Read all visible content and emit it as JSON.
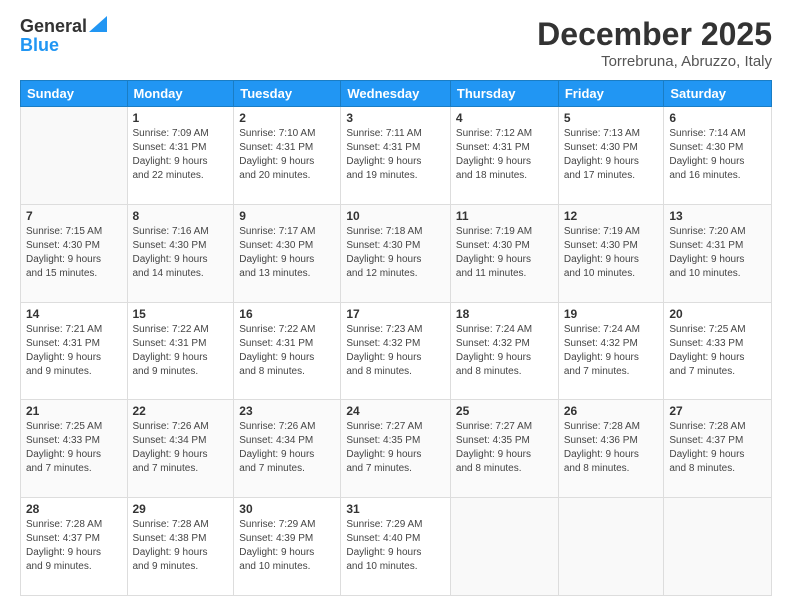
{
  "logo": {
    "general": "General",
    "blue": "Blue"
  },
  "title": "December 2025",
  "location": "Torrebruna, Abruzzo, Italy",
  "days_of_week": [
    "Sunday",
    "Monday",
    "Tuesday",
    "Wednesday",
    "Thursday",
    "Friday",
    "Saturday"
  ],
  "weeks": [
    [
      {
        "day": "",
        "info": ""
      },
      {
        "day": "1",
        "info": "Sunrise: 7:09 AM\nSunset: 4:31 PM\nDaylight: 9 hours\nand 22 minutes."
      },
      {
        "day": "2",
        "info": "Sunrise: 7:10 AM\nSunset: 4:31 PM\nDaylight: 9 hours\nand 20 minutes."
      },
      {
        "day": "3",
        "info": "Sunrise: 7:11 AM\nSunset: 4:31 PM\nDaylight: 9 hours\nand 19 minutes."
      },
      {
        "day": "4",
        "info": "Sunrise: 7:12 AM\nSunset: 4:31 PM\nDaylight: 9 hours\nand 18 minutes."
      },
      {
        "day": "5",
        "info": "Sunrise: 7:13 AM\nSunset: 4:30 PM\nDaylight: 9 hours\nand 17 minutes."
      },
      {
        "day": "6",
        "info": "Sunrise: 7:14 AM\nSunset: 4:30 PM\nDaylight: 9 hours\nand 16 minutes."
      }
    ],
    [
      {
        "day": "7",
        "info": "Sunrise: 7:15 AM\nSunset: 4:30 PM\nDaylight: 9 hours\nand 15 minutes."
      },
      {
        "day": "8",
        "info": "Sunrise: 7:16 AM\nSunset: 4:30 PM\nDaylight: 9 hours\nand 14 minutes."
      },
      {
        "day": "9",
        "info": "Sunrise: 7:17 AM\nSunset: 4:30 PM\nDaylight: 9 hours\nand 13 minutes."
      },
      {
        "day": "10",
        "info": "Sunrise: 7:18 AM\nSunset: 4:30 PM\nDaylight: 9 hours\nand 12 minutes."
      },
      {
        "day": "11",
        "info": "Sunrise: 7:19 AM\nSunset: 4:30 PM\nDaylight: 9 hours\nand 11 minutes."
      },
      {
        "day": "12",
        "info": "Sunrise: 7:19 AM\nSunset: 4:30 PM\nDaylight: 9 hours\nand 10 minutes."
      },
      {
        "day": "13",
        "info": "Sunrise: 7:20 AM\nSunset: 4:31 PM\nDaylight: 9 hours\nand 10 minutes."
      }
    ],
    [
      {
        "day": "14",
        "info": "Sunrise: 7:21 AM\nSunset: 4:31 PM\nDaylight: 9 hours\nand 9 minutes."
      },
      {
        "day": "15",
        "info": "Sunrise: 7:22 AM\nSunset: 4:31 PM\nDaylight: 9 hours\nand 9 minutes."
      },
      {
        "day": "16",
        "info": "Sunrise: 7:22 AM\nSunset: 4:31 PM\nDaylight: 9 hours\nand 8 minutes."
      },
      {
        "day": "17",
        "info": "Sunrise: 7:23 AM\nSunset: 4:32 PM\nDaylight: 9 hours\nand 8 minutes."
      },
      {
        "day": "18",
        "info": "Sunrise: 7:24 AM\nSunset: 4:32 PM\nDaylight: 9 hours\nand 8 minutes."
      },
      {
        "day": "19",
        "info": "Sunrise: 7:24 AM\nSunset: 4:32 PM\nDaylight: 9 hours\nand 7 minutes."
      },
      {
        "day": "20",
        "info": "Sunrise: 7:25 AM\nSunset: 4:33 PM\nDaylight: 9 hours\nand 7 minutes."
      }
    ],
    [
      {
        "day": "21",
        "info": "Sunrise: 7:25 AM\nSunset: 4:33 PM\nDaylight: 9 hours\nand 7 minutes."
      },
      {
        "day": "22",
        "info": "Sunrise: 7:26 AM\nSunset: 4:34 PM\nDaylight: 9 hours\nand 7 minutes."
      },
      {
        "day": "23",
        "info": "Sunrise: 7:26 AM\nSunset: 4:34 PM\nDaylight: 9 hours\nand 7 minutes."
      },
      {
        "day": "24",
        "info": "Sunrise: 7:27 AM\nSunset: 4:35 PM\nDaylight: 9 hours\nand 7 minutes."
      },
      {
        "day": "25",
        "info": "Sunrise: 7:27 AM\nSunset: 4:35 PM\nDaylight: 9 hours\nand 8 minutes."
      },
      {
        "day": "26",
        "info": "Sunrise: 7:28 AM\nSunset: 4:36 PM\nDaylight: 9 hours\nand 8 minutes."
      },
      {
        "day": "27",
        "info": "Sunrise: 7:28 AM\nSunset: 4:37 PM\nDaylight: 9 hours\nand 8 minutes."
      }
    ],
    [
      {
        "day": "28",
        "info": "Sunrise: 7:28 AM\nSunset: 4:37 PM\nDaylight: 9 hours\nand 9 minutes."
      },
      {
        "day": "29",
        "info": "Sunrise: 7:28 AM\nSunset: 4:38 PM\nDaylight: 9 hours\nand 9 minutes."
      },
      {
        "day": "30",
        "info": "Sunrise: 7:29 AM\nSunset: 4:39 PM\nDaylight: 9 hours\nand 10 minutes."
      },
      {
        "day": "31",
        "info": "Sunrise: 7:29 AM\nSunset: 4:40 PM\nDaylight: 9 hours\nand 10 minutes."
      },
      {
        "day": "",
        "info": ""
      },
      {
        "day": "",
        "info": ""
      },
      {
        "day": "",
        "info": ""
      }
    ]
  ]
}
